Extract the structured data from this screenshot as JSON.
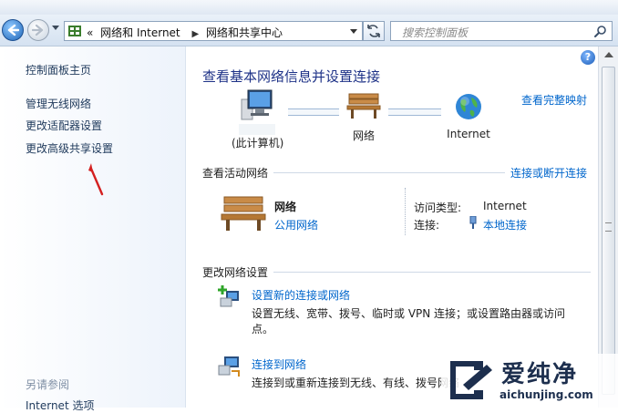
{
  "toolbar": {
    "address_root_chevron": "«",
    "breadcrumb": [
      "网络和 Internet",
      "网络和共享中心"
    ],
    "search_placeholder": "搜索控制面板"
  },
  "sidebar": {
    "items": [
      {
        "label": "控制面板主页"
      },
      {
        "label": "管理无线网络"
      },
      {
        "label": "更改适配器设置"
      },
      {
        "label": "更改高级共享设置"
      }
    ],
    "see_also_label": "另请参阅",
    "see_also_items": [
      {
        "label": "Internet 选项"
      }
    ]
  },
  "main": {
    "title": "查看基本网络信息并设置连接",
    "view_full_map": "查看完整映射",
    "map_nodes": [
      {
        "label": "(此计算机)",
        "icon": "computer-icon"
      },
      {
        "label": "网络",
        "icon": "bench-icon"
      },
      {
        "label": "Internet",
        "icon": "globe-icon"
      }
    ],
    "active_networks": {
      "heading": "查看活动网络",
      "connect_link": "连接或断开连接",
      "network_name": "网络",
      "network_type": "公用网络",
      "access_type_label": "访问类型:",
      "access_type_value": "Internet",
      "connection_label": "连接:",
      "connection_value": "本地连接"
    },
    "change_settings": {
      "heading": "更改网络设置",
      "tasks": [
        {
          "title": "设置新的连接或网络",
          "desc": "设置无线、宽带、拨号、临时或 VPN 连接；或设置路由器或访问点。",
          "icon": "new-connection-icon"
        },
        {
          "title": "连接到网络",
          "desc": "连接到或重新连接到无线、有线、拨号网络",
          "icon": "connect-network-icon"
        }
      ]
    }
  },
  "watermark": {
    "brand": "爱纯净",
    "url": "aichunjing.com"
  },
  "colors": {
    "link": "#0066cc",
    "title": "#1e3287",
    "sidebar_text": "#1e395b",
    "annotation_arrow": "#d42020"
  }
}
